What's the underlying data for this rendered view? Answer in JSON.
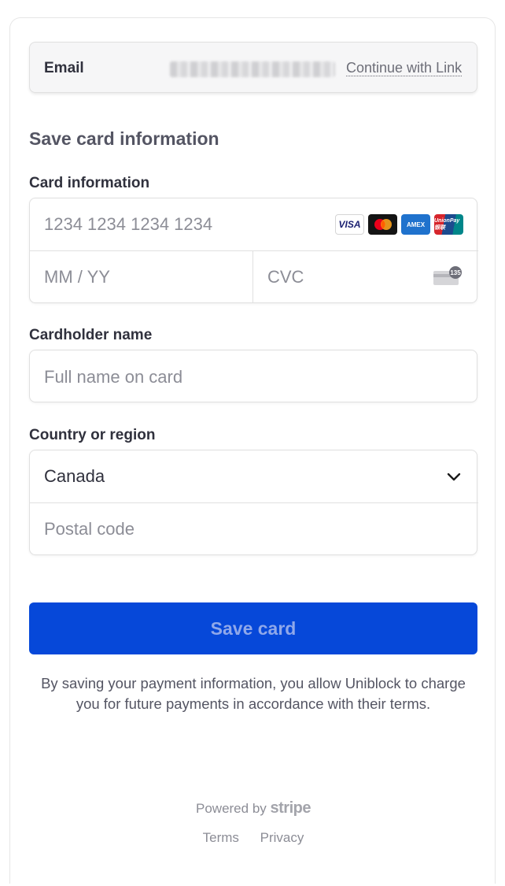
{
  "email": {
    "label": "Email",
    "value": "",
    "value_ellipsis": "…",
    "link_label": "Continue with Link"
  },
  "section_title": "Save card information",
  "card": {
    "label": "Card information",
    "number_placeholder": "1234 1234 1234 1234",
    "expiry_placeholder": "MM / YY",
    "cvc_placeholder": "CVC",
    "cvc_badge": "135",
    "brands": [
      "VISA",
      "mastercard",
      "AMEX",
      "UnionPay 银联"
    ]
  },
  "cardholder": {
    "label": "Cardholder name",
    "placeholder": "Full name on card"
  },
  "country": {
    "label": "Country or region",
    "selected": "Canada",
    "postal_placeholder": "Postal code"
  },
  "save_button": "Save card",
  "consent_text": "By saving your payment information, you allow Uniblock to charge you for future payments in accordance with their terms.",
  "footer": {
    "powered_by": "Powered by",
    "brand": "stripe",
    "terms": "Terms",
    "privacy": "Privacy"
  },
  "colors": {
    "primary": "#0648d9",
    "primary_text_disabled": "#8fa8ea",
    "text": "#30313d",
    "placeholder": "#8c8d96",
    "border": "#e0e0e0"
  }
}
